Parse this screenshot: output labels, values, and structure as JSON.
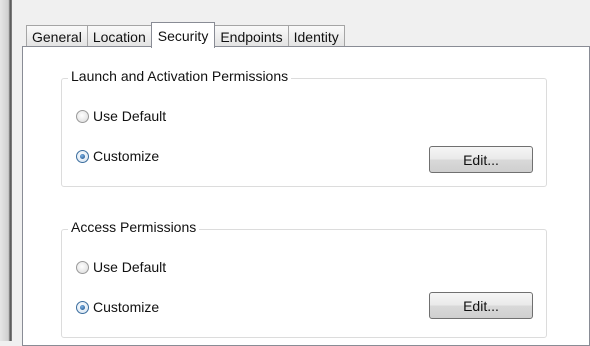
{
  "tabs": [
    {
      "label": "General",
      "active": false
    },
    {
      "label": "Location",
      "active": false
    },
    {
      "label": "Security",
      "active": true
    },
    {
      "label": "Endpoints",
      "active": false
    },
    {
      "label": "Identity",
      "active": false
    }
  ],
  "launch_group": {
    "title": "Launch and Activation Permissions",
    "use_default_label": "Use Default",
    "customize_label": "Customize",
    "selected": "Customize",
    "edit_label": "Edit..."
  },
  "access_group": {
    "title": "Access Permissions",
    "use_default_label": "Use Default",
    "customize_label": "Customize",
    "selected": "Customize",
    "edit_label": "Edit..."
  },
  "colors": {
    "panel_background": "#ffffff",
    "window_background": "#f0f0f0",
    "radio_selected": "#134a84"
  }
}
